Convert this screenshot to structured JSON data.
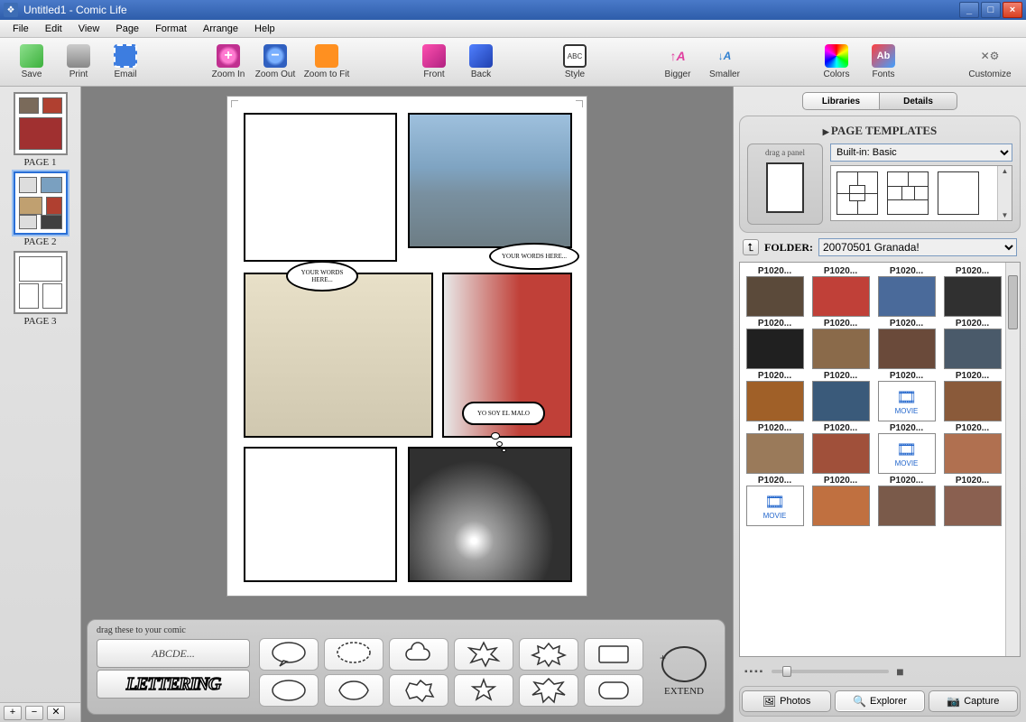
{
  "window": {
    "title": "Untitled1 - Comic Life"
  },
  "menu": {
    "file": "File",
    "edit": "Edit",
    "view": "View",
    "page": "Page",
    "format": "Format",
    "arrange": "Arrange",
    "help": "Help"
  },
  "toolbar": {
    "save": "Save",
    "print": "Print",
    "email": "Email",
    "zoomin": "Zoom In",
    "zoomout": "Zoom Out",
    "zoomfit": "Zoom to Fit",
    "front": "Front",
    "back": "Back",
    "style": "Style",
    "bigger": "Bigger",
    "smaller": "Smaller",
    "colors": "Colors",
    "fonts": "Fonts",
    "customize": "Customize"
  },
  "pages": [
    {
      "label": "PAGE 1"
    },
    {
      "label": "PAGE 2"
    },
    {
      "label": "PAGE 3"
    }
  ],
  "bubbles": {
    "b1": "YOUR WORDS HERE...",
    "b2": "YOUR WORDS HERE...",
    "b3": "YO SOY EL MALO"
  },
  "tray": {
    "title": "drag these to your comic",
    "sample": "ABCDE...",
    "lettering": "LETTERING",
    "extend": "EXTEND"
  },
  "library": {
    "tab_libraries": "Libraries",
    "tab_details": "Details",
    "templates_title": "PAGE TEMPLATES",
    "drag_panel": "drag a panel",
    "template_set": "Built-in: Basic",
    "folder_label": "FOLDER:",
    "folder": "20070501 Granada!",
    "photos": [
      "P1020...",
      "P1020...",
      "P1020...",
      "P1020...",
      "P1020...",
      "P1020...",
      "P1020...",
      "P1020...",
      "P1020...",
      "P1020...",
      "P1020...",
      "P1020...",
      "P1020...",
      "P1020...",
      "P1020...",
      "P1020...",
      "P1020...",
      "P1020...",
      "P1020...",
      "P1020..."
    ],
    "movie_indexes": [
      10,
      14,
      16
    ],
    "source_photos": "Photos",
    "source_explorer": "Explorer",
    "source_capture": "Capture"
  },
  "thumb_colors": [
    "#5b4a3a",
    "#c04038",
    "#4a6a9a",
    "#303030",
    "#202020",
    "#8a6a4a",
    "#6a4a3a",
    "#4a5a6a",
    "#a06028",
    "#3a5a7a",
    "#fff",
    "#8a5a3a",
    "#9a7a5a",
    "#a0503a",
    "#fff",
    "#b07050",
    "#fff",
    "#c07040",
    "#7a5a4a",
    "#8a6050"
  ]
}
